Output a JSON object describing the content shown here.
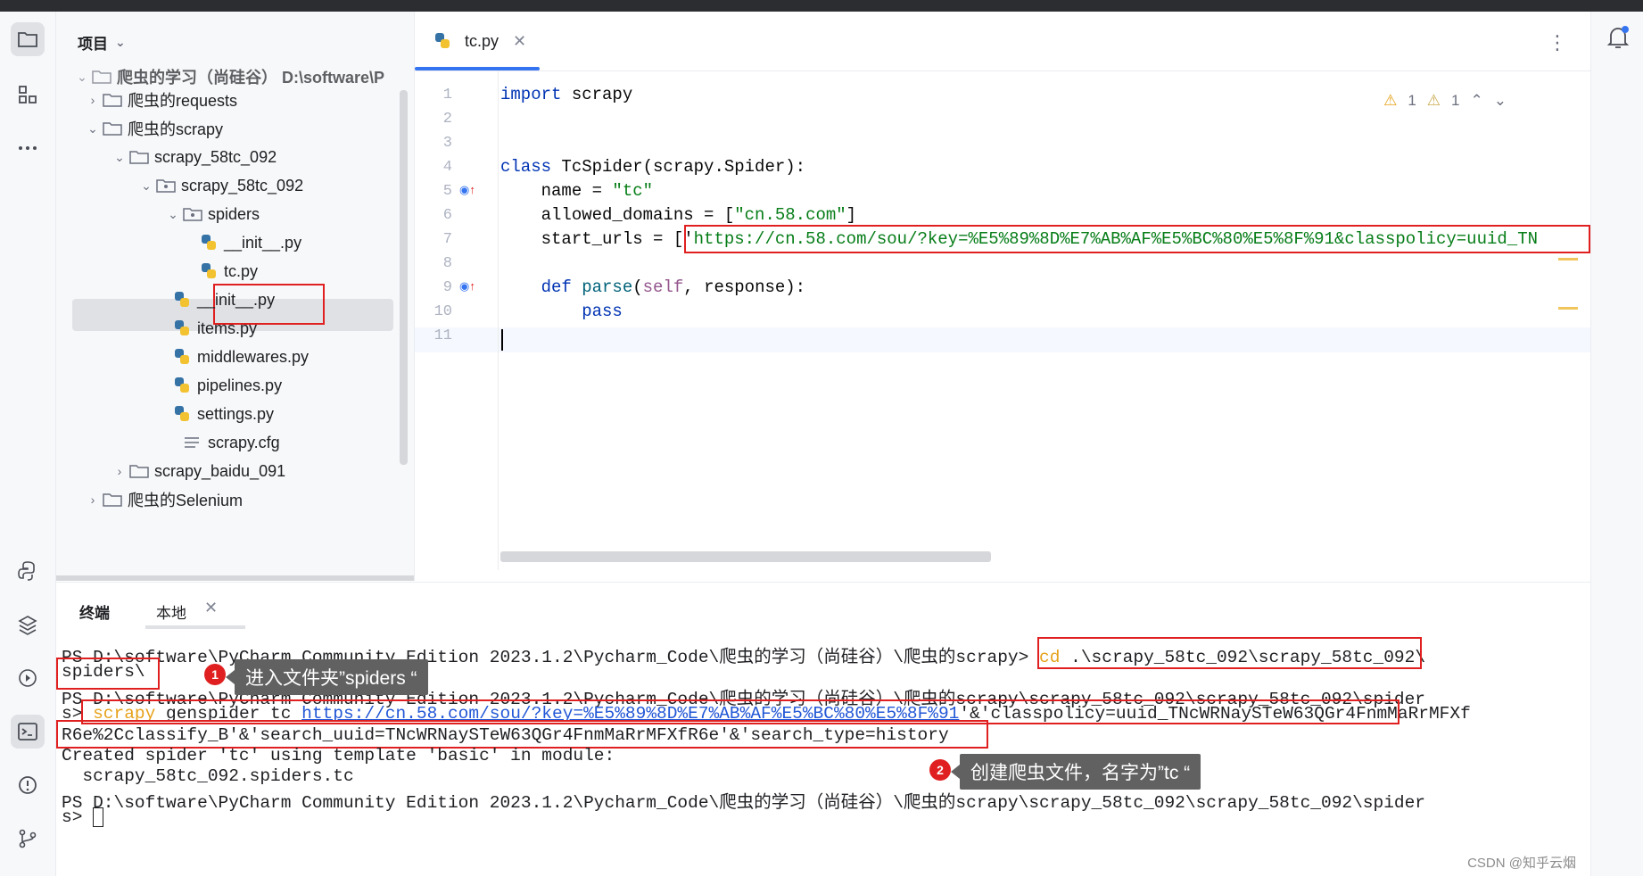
{
  "project_panel": {
    "title": "项目",
    "rows": [
      {
        "label": "爬虫的学习（尚硅谷）  D:\\software\\P"
      },
      {
        "label": "爬虫的requests"
      },
      {
        "label": "爬虫的scrapy"
      },
      {
        "label": "scrapy_58tc_092"
      },
      {
        "label": "scrapy_58tc_092"
      },
      {
        "label": "spiders"
      },
      {
        "label": "__init__.py"
      },
      {
        "label": "tc.py"
      },
      {
        "label": "__init__.py"
      },
      {
        "label": "items.py"
      },
      {
        "label": "middlewares.py"
      },
      {
        "label": "pipelines.py"
      },
      {
        "label": "settings.py"
      },
      {
        "label": "scrapy.cfg"
      },
      {
        "label": "scrapy_baidu_091"
      },
      {
        "label": "爬虫的Selenium"
      }
    ]
  },
  "editor": {
    "tab_label": "tc.py",
    "inspections": {
      "warnings_a": "1",
      "warnings_b": "1"
    },
    "line_numbers": [
      "1",
      "2",
      "3",
      "4",
      "5",
      "6",
      "7",
      "8",
      "9",
      "10",
      "11"
    ],
    "code": {
      "l1_kw": "import",
      "l1_rest": " scrapy",
      "l4_kw": "class",
      "l4_rest": " TcSpider(scrapy.Spider):",
      "l5_pre": "    name = ",
      "l5_str": "\"tc\"",
      "l6_pre": "    allowed_domains = [",
      "l6_str": "\"cn.58.com\"",
      "l6_post": "]",
      "l7_pre": "    start_urls = ['",
      "l7_str": "https://cn.58.com/sou/?key=%E5%89%8D%E7%AB%AF%E5%BC%80%E5%8F%91&classpolicy=uuid_TN",
      "l9_kw": "    def",
      "l9_fn": " parse",
      "l9_open": "(",
      "l9_self": "self",
      "l9_rest": ", response):",
      "l10_kw": "        pass"
    }
  },
  "terminal": {
    "title": "终端",
    "tab_local": "本地",
    "lines": {
      "l1_prompt": "PS D:\\software\\PyCharm Community Edition 2023.1.2\\Pycharm_Code\\爬虫的学习（尚硅谷）\\爬虫的scrapy> ",
      "l1_cmd": "cd",
      "l1_rest": " .\\scrapy_58tc_092\\scrapy_58tc_092\\",
      "l2": "spiders\\",
      "l3": "PS D:\\software\\PyCharm Community Edition 2023.1.2\\Pycharm_Code\\爬虫的学习（尚硅谷）\\爬虫的scrapy\\scrapy_58tc_092\\scrapy_58tc_092\\spider",
      "l4_pre": "s> ",
      "l4_cmd": "scrapy",
      "l4_mid": " genspider tc ",
      "l4_link": "https://cn.58.com/sou/?key=%E5%89%8D%E7%AB%AF%E5%BC%80%E5%8F%91",
      "l4_rest": "'&'classpolicy=uuid_TNcWRNaySTeW63QGr4FnmMaRrMFXf",
      "l5": "R6e%2Cclassify_B'&'search_uuid=TNcWRNaySTeW63QGr4FnmMaRrMFXfR6e'&'search_type=history",
      "l6": "Created spider 'tc' using template 'basic' in module:",
      "l7": "  scrapy_58tc_092.spiders.tc",
      "l8": "PS D:\\software\\PyCharm Community Edition 2023.1.2\\Pycharm_Code\\爬虫的学习（尚硅谷）\\爬虫的scrapy\\scrapy_58tc_092\\scrapy_58tc_092\\spider",
      "l9": "s> "
    }
  },
  "annotations": {
    "badge1": "1",
    "callout1": "进入文件夹”spiders “",
    "badge2": "2",
    "callout2": "创建爬虫文件，名字为”tc “"
  },
  "watermark": "CSDN @知乎云烟",
  "colors": {
    "accent": "#3574f0",
    "highlight_box": "#e02020",
    "keyword": "#0033b3",
    "string": "#067d17"
  }
}
